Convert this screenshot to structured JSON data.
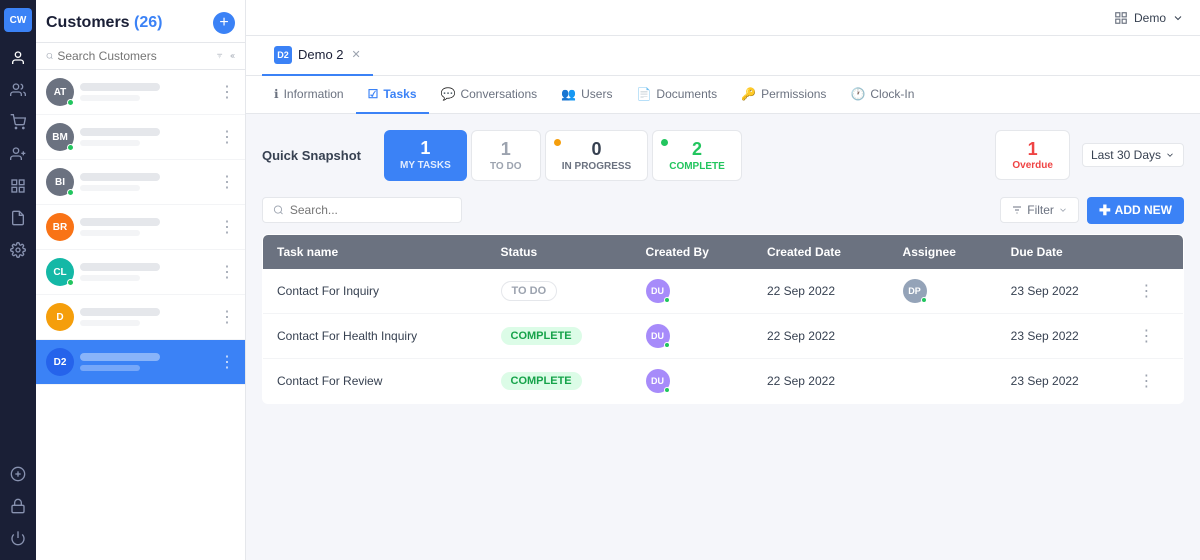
{
  "app": {
    "demo_label": "Demo",
    "logo_text": "CW"
  },
  "customers_panel": {
    "title": "Customers",
    "count": "(26)",
    "search_placeholder": "Search Customers",
    "add_btn_label": "+",
    "customers": [
      {
        "id": "AT",
        "color": "#6b7280",
        "has_dot": true
      },
      {
        "id": "BM",
        "color": "#6b7280",
        "has_dot": true
      },
      {
        "id": "BI",
        "color": "#6b7280",
        "has_dot": true
      },
      {
        "id": "BR",
        "color": "#f97316",
        "has_dot": false
      },
      {
        "id": "CL",
        "color": "#14b8a6",
        "has_dot": true
      },
      {
        "id": "D",
        "color": "#f59e0b",
        "has_dot": false
      },
      {
        "id": "D2",
        "color": "#3b82f6",
        "has_dot": false,
        "active": true
      }
    ]
  },
  "tabs": [
    {
      "id": "demo2",
      "label": "Demo 2",
      "avatar": "D2",
      "active": true
    }
  ],
  "sub_nav": [
    {
      "icon": "ℹ",
      "label": "Information",
      "active": false
    },
    {
      "icon": "☑",
      "label": "Tasks",
      "active": true
    },
    {
      "icon": "💬",
      "label": "Conversations",
      "active": false
    },
    {
      "icon": "👥",
      "label": "Users",
      "active": false
    },
    {
      "icon": "📄",
      "label": "Documents",
      "active": false
    },
    {
      "icon": "🔑",
      "label": "Permissions",
      "active": false
    },
    {
      "icon": "🕐",
      "label": "Clock-In",
      "active": false
    }
  ],
  "quick_snapshot": {
    "label": "Quick Snapshot",
    "cards": [
      {
        "id": "my_tasks",
        "num": "1",
        "label": "My Tasks",
        "active": true
      },
      {
        "id": "todo",
        "num": "1",
        "label": "TO DO",
        "active": false,
        "type": "todo"
      },
      {
        "id": "inprogress",
        "num": "0",
        "label": "IN PROGRESS",
        "active": false,
        "type": "inprogress"
      },
      {
        "id": "complete",
        "num": "2",
        "label": "COMPLETE",
        "active": false,
        "type": "complete"
      }
    ],
    "overdue": {
      "num": "1",
      "label": "Overdue"
    },
    "date_range": "Last 30 Days"
  },
  "toolbar": {
    "search_placeholder": "Search...",
    "filter_label": "Filter",
    "add_new_label": "ADD NEW"
  },
  "table": {
    "headers": [
      "Task name",
      "Status",
      "Created By",
      "Created Date",
      "Assignee",
      "Due Date",
      ""
    ],
    "rows": [
      {
        "task_name": "Contact For Inquiry",
        "status": "TO DO",
        "status_type": "todo",
        "created_by_initials": "DU",
        "created_by_color": "#a78bfa",
        "created_date": "22 Sep 2022",
        "assignee_initials": "DP",
        "assignee_color": "#94a3b8",
        "due_date": "23 Sep 2022"
      },
      {
        "task_name": "Contact For Health Inquiry",
        "status": "COMPLETE",
        "status_type": "complete",
        "created_by_initials": "DU",
        "created_by_color": "#a78bfa",
        "created_date": "22 Sep 2022",
        "assignee_initials": "",
        "assignee_color": "",
        "due_date": "23 Sep 2022"
      },
      {
        "task_name": "Contact For Review",
        "status": "COMPLETE",
        "status_type": "complete",
        "created_by_initials": "DU",
        "created_by_color": "#a78bfa",
        "created_date": "22 Sep 2022",
        "assignee_initials": "",
        "assignee_color": "",
        "due_date": "23 Sep 2022"
      }
    ]
  }
}
